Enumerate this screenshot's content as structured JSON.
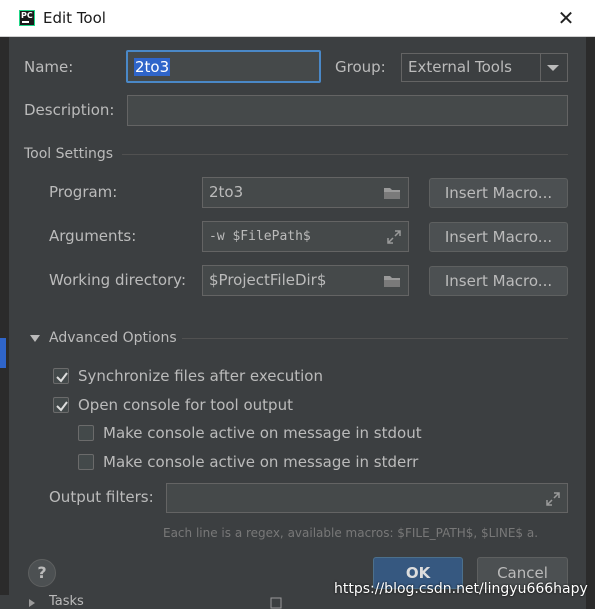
{
  "window": {
    "title": "Edit Tool",
    "app_logo_text": "PC"
  },
  "name": {
    "label": "Name:",
    "value": "2to3"
  },
  "group": {
    "label": "Group:",
    "value": "External Tools"
  },
  "description": {
    "label": "Description:",
    "value": ""
  },
  "tool_settings": {
    "header": "Tool Settings",
    "program": {
      "label": "Program:",
      "value": "2to3"
    },
    "arguments": {
      "label": "Arguments:",
      "value": "-w $FilePath$"
    },
    "working_directory": {
      "label": "Working directory:",
      "value": "$ProjectFileDir$"
    },
    "insert_macro_label": "Insert Macro..."
  },
  "advanced": {
    "header": "Advanced Options",
    "sync_files": {
      "label": "Synchronize files after execution",
      "checked": true
    },
    "open_console": {
      "label": "Open console for tool output",
      "checked": true
    },
    "active_stdout": {
      "label": "Make console active on message in stdout",
      "checked": false
    },
    "active_stderr": {
      "label": "Make console active on message in stderr",
      "checked": false
    },
    "output_filters": {
      "label": "Output filters:",
      "value": ""
    },
    "hint": "Each line is a regex, available macros: $FILE_PATH$, $LINE$ a."
  },
  "buttons": {
    "help": "?",
    "ok": "OK",
    "cancel": "Cancel"
  },
  "background": {
    "sidebar_item": "Tasks"
  },
  "watermark": "https://blog.csdn.net/lingyu666hapy",
  "colors": {
    "dialog_bg": "#3c3f41",
    "field_bg": "#45494a",
    "focus_border": "#4a88c7",
    "selection": "#2f65ca",
    "ok_button": "#365880"
  }
}
